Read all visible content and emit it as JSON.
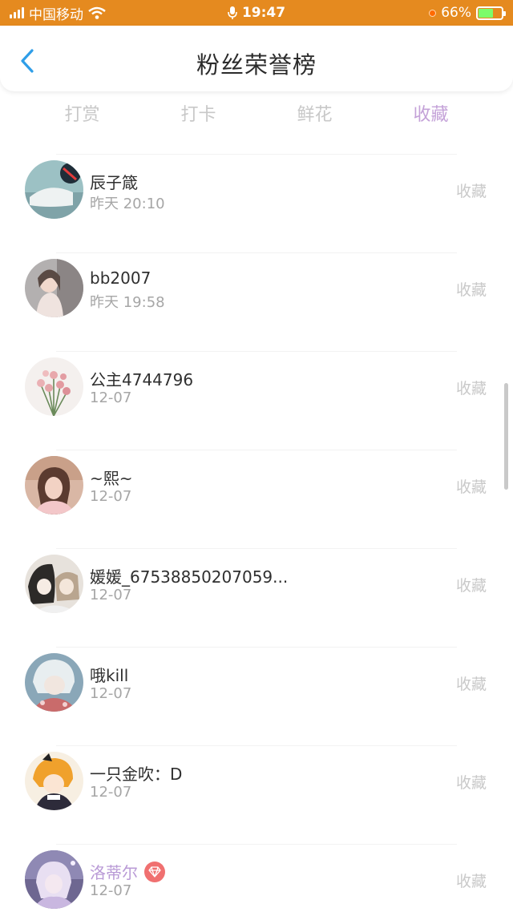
{
  "status_bar": {
    "carrier": "中国移动",
    "time": "19:47",
    "battery": "66%",
    "battery_level": 0.66
  },
  "nav": {
    "title": "粉丝荣誉榜",
    "back_icon": "chevron-left-icon"
  },
  "tabs": [
    {
      "label": "打赏",
      "active": false
    },
    {
      "label": "打卡",
      "active": false
    },
    {
      "label": "鲜花",
      "active": false
    },
    {
      "label": "收藏",
      "active": true
    }
  ],
  "fans": [
    {
      "name": "辰子箴",
      "time": "昨天 20:10",
      "action": "收藏",
      "vip": false
    },
    {
      "name": "bb2007",
      "time": "昨天 19:58",
      "action": "收藏",
      "vip": false
    },
    {
      "name": "公主4744796",
      "time": "12-07",
      "action": "收藏",
      "vip": false
    },
    {
      "name": "~熙~",
      "time": "12-07",
      "action": "收藏",
      "vip": false
    },
    {
      "name": "媛媛_67538850207059...",
      "time": "12-07",
      "action": "收藏",
      "vip": false
    },
    {
      "name": "哦kill",
      "time": "12-07",
      "action": "收藏",
      "vip": false
    },
    {
      "name": "一只金吹：D",
      "time": "12-07",
      "action": "收藏",
      "vip": false
    },
    {
      "name": "洛蒂尔",
      "time": "12-07",
      "action": "收藏",
      "vip": true
    }
  ],
  "colors": {
    "status_bar": "#e58a1f",
    "accent_blue": "#2f9ee8",
    "tab_active": "#c4a2d8",
    "vip_name": "#b99ad6",
    "vip_badge": "#f07070"
  }
}
